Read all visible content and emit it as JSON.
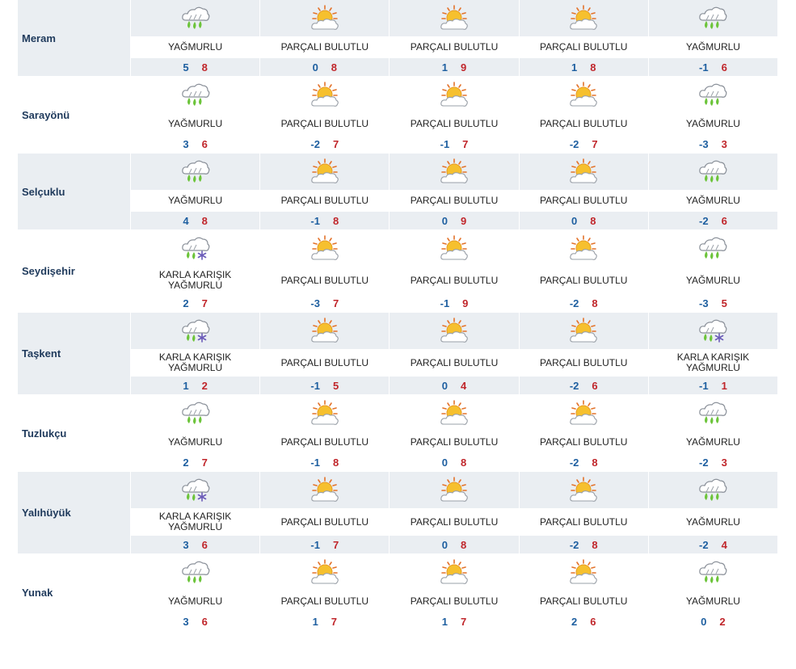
{
  "conditions": {
    "rain": "YAĞMURLU",
    "partly": "PARÇALI BULUTLU",
    "sleet": "KARLA KARIŞIK YAĞMURLU"
  },
  "icons": {
    "rain": "rain-cloud-icon",
    "partly": "sun-behind-cloud-icon",
    "sleet": "sleet-cloud-icon"
  },
  "colors": {
    "row_alt_bg": "#eaeef2",
    "city_text": "#1f3a5c",
    "temp_min": "#1e5fa0",
    "temp_max": "#c0262b"
  },
  "rows": [
    {
      "city": "Meram",
      "days": [
        {
          "cond": "rain",
          "min": "5",
          "max": "8"
        },
        {
          "cond": "partly",
          "min": "0",
          "max": "8"
        },
        {
          "cond": "partly",
          "min": "1",
          "max": "9"
        },
        {
          "cond": "partly",
          "min": "1",
          "max": "8"
        },
        {
          "cond": "rain",
          "min": "-1",
          "max": "6"
        }
      ]
    },
    {
      "city": "Sarayönü",
      "days": [
        {
          "cond": "rain",
          "min": "3",
          "max": "6"
        },
        {
          "cond": "partly",
          "min": "-2",
          "max": "7"
        },
        {
          "cond": "partly",
          "min": "-1",
          "max": "7"
        },
        {
          "cond": "partly",
          "min": "-2",
          "max": "7"
        },
        {
          "cond": "rain",
          "min": "-3",
          "max": "3"
        }
      ]
    },
    {
      "city": "Selçuklu",
      "days": [
        {
          "cond": "rain",
          "min": "4",
          "max": "8"
        },
        {
          "cond": "partly",
          "min": "-1",
          "max": "8"
        },
        {
          "cond": "partly",
          "min": "0",
          "max": "9"
        },
        {
          "cond": "partly",
          "min": "0",
          "max": "8"
        },
        {
          "cond": "rain",
          "min": "-2",
          "max": "6"
        }
      ]
    },
    {
      "city": "Seydişehir",
      "days": [
        {
          "cond": "sleet",
          "min": "2",
          "max": "7"
        },
        {
          "cond": "partly",
          "min": "-3",
          "max": "7"
        },
        {
          "cond": "partly",
          "min": "-1",
          "max": "9"
        },
        {
          "cond": "partly",
          "min": "-2",
          "max": "8"
        },
        {
          "cond": "rain",
          "min": "-3",
          "max": "5"
        }
      ]
    },
    {
      "city": "Taşkent",
      "days": [
        {
          "cond": "sleet",
          "min": "1",
          "max": "2"
        },
        {
          "cond": "partly",
          "min": "-1",
          "max": "5"
        },
        {
          "cond": "partly",
          "min": "0",
          "max": "4"
        },
        {
          "cond": "partly",
          "min": "-2",
          "max": "6"
        },
        {
          "cond": "sleet",
          "min": "-1",
          "max": "1"
        }
      ]
    },
    {
      "city": "Tuzlukçu",
      "days": [
        {
          "cond": "rain",
          "min": "2",
          "max": "7"
        },
        {
          "cond": "partly",
          "min": "-1",
          "max": "8"
        },
        {
          "cond": "partly",
          "min": "0",
          "max": "8"
        },
        {
          "cond": "partly",
          "min": "-2",
          "max": "8"
        },
        {
          "cond": "rain",
          "min": "-2",
          "max": "3"
        }
      ]
    },
    {
      "city": "Yalıhüyük",
      "days": [
        {
          "cond": "sleet",
          "min": "3",
          "max": "6"
        },
        {
          "cond": "partly",
          "min": "-1",
          "max": "7"
        },
        {
          "cond": "partly",
          "min": "0",
          "max": "8"
        },
        {
          "cond": "partly",
          "min": "-2",
          "max": "8"
        },
        {
          "cond": "rain",
          "min": "-2",
          "max": "4"
        }
      ]
    },
    {
      "city": "Yunak",
      "days": [
        {
          "cond": "rain",
          "min": "3",
          "max": "6"
        },
        {
          "cond": "partly",
          "min": "1",
          "max": "7"
        },
        {
          "cond": "partly",
          "min": "1",
          "max": "7"
        },
        {
          "cond": "partly",
          "min": "2",
          "max": "6"
        },
        {
          "cond": "rain",
          "min": "0",
          "max": "2"
        }
      ]
    }
  ]
}
